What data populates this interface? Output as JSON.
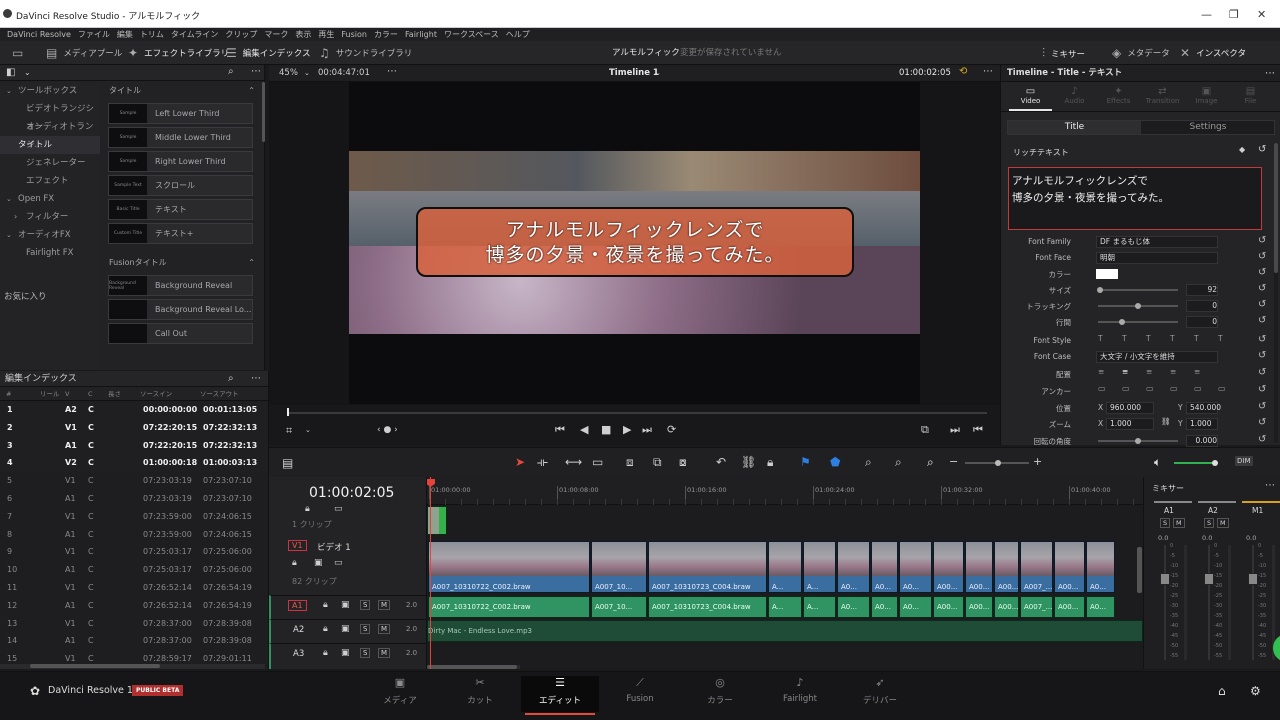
{
  "window": {
    "title": "DaVinci Resolve Studio - アルモルフィック"
  },
  "menu": [
    "DaVinci Resolve",
    "ファイル",
    "編集",
    "トリム",
    "タイムライン",
    "クリップ",
    "マーク",
    "表示",
    "再生",
    "Fusion",
    "カラー",
    "Fairlight",
    "ワークスペース",
    "ヘルプ"
  ],
  "toolbar": {
    "media_pool": "メディアプール",
    "effects_library": "エフェクトライブラリ",
    "edit_index": "編集インデックス",
    "sound_library": "サウンドライブラリ",
    "project_name": "アルモルフィック",
    "save_status": "変更が保存されていません",
    "mixer": "ミキサー",
    "metadata": "メタデータ",
    "inspector": "インスペクタ"
  },
  "effects": {
    "tree": [
      {
        "label": "ツールボックス",
        "level": 0
      },
      {
        "label": "ビデオトランジション",
        "level": 1
      },
      {
        "label": "オーディオトランジ...",
        "level": 1
      },
      {
        "label": "タイトル",
        "level": 0,
        "selected": true
      },
      {
        "label": "ジェネレーター",
        "level": 1
      },
      {
        "label": "エフェクト",
        "level": 1
      },
      {
        "label": "Open FX",
        "level": 0
      },
      {
        "label": "フィルター",
        "level": 2
      },
      {
        "label": "オーディオFX",
        "level": 0
      },
      {
        "label": "Fairlight FX",
        "level": 1
      }
    ],
    "favorites": "お気に入り",
    "titles_header": "タイトル",
    "titles": [
      {
        "label": "Left Lower Third",
        "thumb": "Sample"
      },
      {
        "label": "Middle Lower Third",
        "thumb": "Sample"
      },
      {
        "label": "Right Lower Third",
        "thumb": "Sample"
      },
      {
        "label": "スクロール",
        "thumb": "Sample Text"
      },
      {
        "label": "テキスト",
        "thumb": "Basic Title"
      },
      {
        "label": "テキスト+",
        "thumb": "Custom Title"
      }
    ],
    "fusion_header": "Fusionタイトル",
    "fusion_titles": [
      {
        "label": "Background Reveal",
        "thumb": "Background Reveal"
      },
      {
        "label": "Background Reveal Lo...",
        "thumb": ""
      },
      {
        "label": "Call Out",
        "thumb": ""
      }
    ]
  },
  "edit_index": {
    "title": "編集インデックス",
    "columns": [
      "#",
      "リール",
      "V",
      "C",
      "長さ",
      "ソースイン",
      "ソースアウト"
    ],
    "rows": [
      {
        "n": "1",
        "track": "A2",
        "c": "C",
        "src_in": "00:00:00:00",
        "src_out": "00:01:13:05",
        "bold": true
      },
      {
        "n": "2",
        "track": "V1",
        "c": "C",
        "src_in": "07:22:20:15",
        "src_out": "07:22:32:13",
        "bold": true
      },
      {
        "n": "3",
        "track": "A1",
        "c": "C",
        "src_in": "07:22:20:15",
        "src_out": "07:22:32:13",
        "bold": true
      },
      {
        "n": "4",
        "track": "V2",
        "c": "C",
        "src_in": "01:00:00:18",
        "src_out": "01:00:03:13",
        "bold": true
      },
      {
        "n": "5",
        "track": "V1",
        "c": "C",
        "src_in": "07:23:03:19",
        "src_out": "07:23:07:10",
        "bold": false
      },
      {
        "n": "6",
        "track": "A1",
        "c": "C",
        "src_in": "07:23:03:19",
        "src_out": "07:23:07:10",
        "bold": false
      },
      {
        "n": "7",
        "track": "V1",
        "c": "C",
        "src_in": "07:23:59:00",
        "src_out": "07:24:06:15",
        "bold": false
      },
      {
        "n": "8",
        "track": "A1",
        "c": "C",
        "src_in": "07:23:59:00",
        "src_out": "07:24:06:15",
        "bold": false
      },
      {
        "n": "9",
        "track": "V1",
        "c": "C",
        "src_in": "07:25:03:17",
        "src_out": "07:25:06:00",
        "bold": false
      },
      {
        "n": "10",
        "track": "A1",
        "c": "C",
        "src_in": "07:25:03:17",
        "src_out": "07:25:06:00",
        "bold": false
      },
      {
        "n": "11",
        "track": "V1",
        "c": "C",
        "src_in": "07:26:52:14",
        "src_out": "07:26:54:19",
        "bold": false
      },
      {
        "n": "12",
        "track": "A1",
        "c": "C",
        "src_in": "07:26:52:14",
        "src_out": "07:26:54:19",
        "bold": false
      },
      {
        "n": "13",
        "track": "V1",
        "c": "C",
        "src_in": "07:28:37:00",
        "src_out": "07:28:39:08",
        "bold": false
      },
      {
        "n": "14",
        "track": "A1",
        "c": "C",
        "src_in": "07:28:37:00",
        "src_out": "07:28:39:08",
        "bold": false
      },
      {
        "n": "15",
        "track": "V1",
        "c": "C",
        "src_in": "07:28:59:17",
        "src_out": "07:29:01:11",
        "bold": false
      }
    ]
  },
  "viewer": {
    "zoom": "45%",
    "source_tc": "00:04:47:01",
    "timeline_name": "Timeline 1",
    "record_tc": "01:00:02:05",
    "caption_line1": "アナルモルフィックレンズで",
    "caption_line2": "博多の夕景・夜景を撮ってみた。"
  },
  "inspector": {
    "header": "Timeline - Title - テキスト",
    "tabs": [
      "Video",
      "Audio",
      "Effects",
      "Transition",
      "Image",
      "File"
    ],
    "subtabs": [
      "Title",
      "Settings"
    ],
    "section": "リッチテキスト",
    "text_line1": "アナルモルフィックレンズで",
    "text_line2": "博多の夕景・夜景を撮ってみた。",
    "font_family_label": "Font Family",
    "font_family": "DF まるもじ体",
    "font_face_label": "Font Face",
    "font_face": "明朝",
    "color_label": "カラー",
    "size_label": "サイズ",
    "size": "92",
    "tracking_label": "トラッキング",
    "tracking": "0",
    "line_spacing_label": "行間",
    "line_spacing": "0",
    "font_style_label": "Font Style",
    "font_case_label": "Font Case",
    "font_case": "大文字 / 小文字を維持",
    "alignment_label": "配置",
    "anchor_label": "アンカー",
    "position_label": "位置",
    "pos_x": "960.000",
    "pos_y": "540.000",
    "zoom_label": "ズーム",
    "zoom_x": "1.000",
    "zoom_y": "1.000",
    "rotation_label": "回転の角度",
    "rotation": "0.000",
    "axis_x": "X",
    "axis_y": "Y"
  },
  "timeline": {
    "timecode": "01:00:02:05",
    "ruler": [
      "01:00:00:00",
      "01:00:08:00",
      "01:00:16:00",
      "01:00:24:00",
      "01:00:32:00",
      "01:00:40:00"
    ],
    "v2_info": "1 クリップ",
    "v1_badge": "V1",
    "v1_name": "ビデオ 1",
    "v1_info": "82 クリップ",
    "a1_badge": "A1",
    "a2_label": "A2",
    "a3_label": "A3",
    "audio_level": "2.0",
    "video_clips": [
      {
        "name": "A007_10310722_C002.braw",
        "w": 163
      },
      {
        "name": "A007_10...",
        "w": 57
      },
      {
        "name": "A007_10310723_C004.braw",
        "w": 120
      },
      {
        "name": "A...",
        "w": 35
      },
      {
        "name": "A...",
        "w": 34
      },
      {
        "name": "A0...",
        "w": 34
      },
      {
        "name": "A0...",
        "w": 28
      },
      {
        "name": "A0...",
        "w": 34
      },
      {
        "name": "A00...",
        "w": 32
      },
      {
        "name": "A00...",
        "w": 29
      },
      {
        "name": "A00...",
        "w": 26
      },
      {
        "name": "A007_...",
        "w": 34
      },
      {
        "name": "A00...",
        "w": 32
      },
      {
        "name": "A0...",
        "w": 30
      }
    ],
    "audio_track": "Dirty Mac - Endless Love.mp3"
  },
  "mixer": {
    "title": "ミキサー",
    "channels": [
      "A1",
      "A2",
      "M1"
    ],
    "level": "0.0",
    "scale": [
      "0",
      "-5",
      "-10",
      "-15",
      "-20",
      "-25",
      "-30",
      "-35",
      "-40",
      "-45",
      "-50",
      "-55"
    ]
  },
  "pages": [
    {
      "label": "メディア",
      "icon": "▣"
    },
    {
      "label": "カット",
      "icon": "✂"
    },
    {
      "label": "エディット",
      "icon": "☰",
      "active": true
    },
    {
      "label": "Fusion",
      "icon": "⟋"
    },
    {
      "label": "カラー",
      "icon": "◎"
    },
    {
      "label": "Fairlight",
      "icon": "♪"
    },
    {
      "label": "デリバー",
      "icon": "➶"
    }
  ],
  "brand": {
    "name": "DaVinci Resolve 17",
    "badge": "PUBLIC BETA"
  }
}
